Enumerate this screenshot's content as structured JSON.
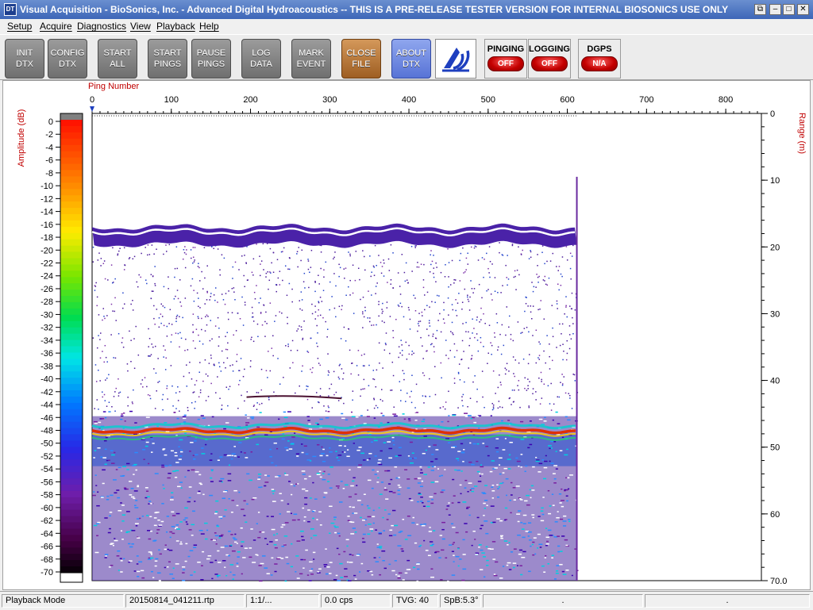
{
  "window": {
    "title": "Visual Acquisition  -  BioSonics, Inc.  -  Advanced Digital Hydroacoustics  -- THIS IS A PRE-RELEASE TESTER VERSION FOR INTERNAL BIOSONICS USE ONLY",
    "icon_text": "DT",
    "buttons": [
      "restore",
      "minimize",
      "maximize",
      "close"
    ]
  },
  "menu": [
    "Setup",
    "Acquire",
    "Diagnostics",
    "View",
    "Playback",
    "Help"
  ],
  "toolbar": {
    "buttons": [
      {
        "line1": "INIT",
        "line2": "DTX"
      },
      {
        "line1": "CONFIG",
        "line2": "DTX"
      },
      {
        "line1": "START",
        "line2": "ALL"
      },
      {
        "line1": "START",
        "line2": "PINGS"
      },
      {
        "line1": "PAUSE",
        "line2": "PINGS"
      },
      {
        "line1": "LOG",
        "line2": "DATA"
      },
      {
        "line1": "MARK",
        "line2": "EVENT"
      },
      {
        "line1": "CLOSE",
        "line2": "FILE"
      },
      {
        "line1": "ABOUT",
        "line2": "DTX"
      }
    ],
    "logo_icon": "biosonics-logo-icon",
    "status": [
      {
        "label": "PINGING",
        "value": "OFF"
      },
      {
        "label": "LOGGING",
        "value": "OFF"
      },
      {
        "label": "DGPS",
        "value": "N/A"
      }
    ],
    "status_color": "#d10000"
  },
  "plot": {
    "x_axis_title": "Ping Number",
    "x_ticks": [
      "0",
      "100",
      "200",
      "300",
      "400",
      "500",
      "600",
      "700",
      "800"
    ],
    "amplitude_label": "Amplitude (dB)",
    "amplitude_ticks": [
      "0",
      "-2",
      "-4",
      "-6",
      "-8",
      "-10",
      "-12",
      "-14",
      "-16",
      "-18",
      "-20",
      "-22",
      "-24",
      "-26",
      "-28",
      "-30",
      "-32",
      "-34",
      "-36",
      "-38",
      "-40",
      "-42",
      "-44",
      "-46",
      "-48",
      "-50",
      "-52",
      "-54",
      "-56",
      "-58",
      "-60",
      "-62",
      "-64",
      "-66",
      "-68",
      "-70"
    ],
    "range_label": "Range (m)",
    "range_ticks": [
      "0",
      "10",
      "20",
      "30",
      "40",
      "50",
      "60",
      "70.0"
    ],
    "data_extent_pings": 612,
    "x_max_pings": 845,
    "range_max_m": 70,
    "bottom_depth_m": 47.5,
    "surface_layer_m": 17.5,
    "colors": {
      "axis_text": "#c00000",
      "tick_text": "#000000",
      "bottom_echo": "#e03000"
    }
  },
  "statusbar": [
    "Playback Mode",
    "20150814_041211.rtp",
    "1:1/...",
    "0.0 cps",
    "TVG: 40",
    "SpB:5.3°",
    ".",
    "."
  ]
}
